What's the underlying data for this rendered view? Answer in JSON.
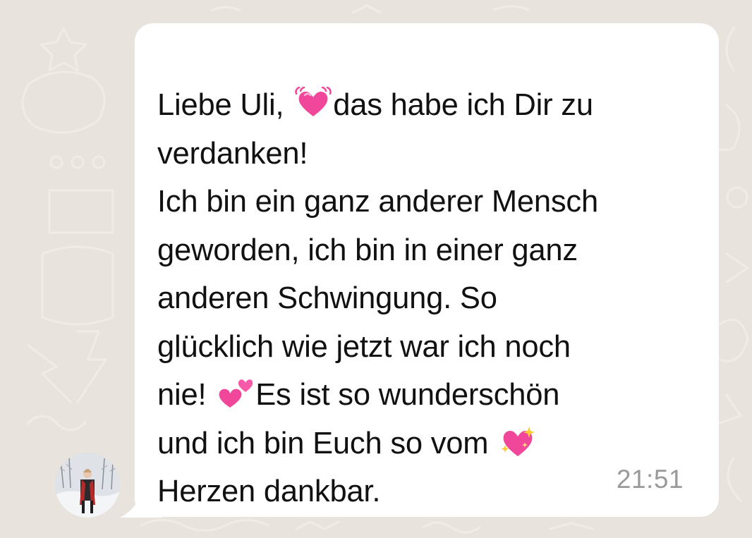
{
  "chat": {
    "message": {
      "line1_before_emoji": "Liebe Uli, ",
      "line1_after_emoji": "das habe ich Dir zu",
      "line2": "verdanken!",
      "line3": "Ich bin ein ganz anderer Mensch",
      "line4": "geworden, ich bin in einer ganz",
      "line5": "anderen Schwingung. So",
      "line6": "glücklich wie jetzt war ich noch",
      "line7_before_emoji": "nie! ",
      "line7_after_emoji": "Es ist so wunderschön",
      "line8_before_emoji": "und ich bin Euch so vom ",
      "line9": "Herzen dankbar.",
      "timestamp": "21:51"
    },
    "emojis": {
      "first": "beating-heart-icon",
      "second": "two-hearts-icon",
      "third": "sparkling-heart-icon"
    },
    "colors": {
      "background": "#e8e4dd",
      "bubble": "#ffffff",
      "text": "#111111",
      "timestamp": "#9a9a9a",
      "heart_pink": "#f0479a"
    }
  }
}
